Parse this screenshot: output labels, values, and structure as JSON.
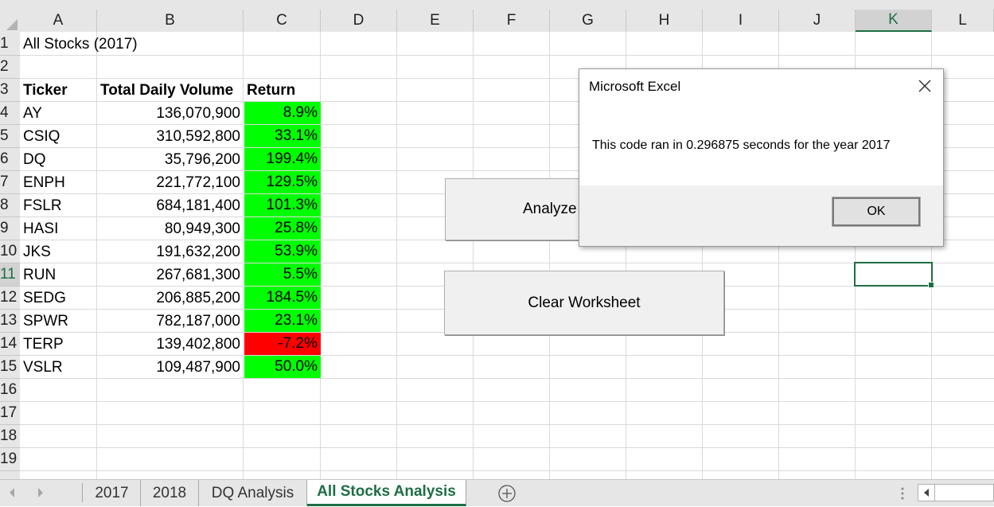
{
  "columns": [
    "A",
    "B",
    "C",
    "D",
    "E",
    "F",
    "G",
    "H",
    "I",
    "J",
    "K",
    "L"
  ],
  "rows": [
    "1",
    "2",
    "3",
    "4",
    "5",
    "6",
    "7",
    "8",
    "9",
    "10",
    "11",
    "12",
    "13",
    "14",
    "15",
    "16",
    "17",
    "18",
    "19"
  ],
  "sheet_title": "All Stocks (2017)",
  "table": {
    "headers": [
      "Ticker",
      "Total Daily Volume",
      "Return"
    ],
    "rows": [
      {
        "ticker": "AY",
        "volume": "136,070,900",
        "return": "8.9%",
        "status": "positive"
      },
      {
        "ticker": "CSIQ",
        "volume": "310,592,800",
        "return": "33.1%",
        "status": "positive"
      },
      {
        "ticker": "DQ",
        "volume": "35,796,200",
        "return": "199.4%",
        "status": "positive"
      },
      {
        "ticker": "ENPH",
        "volume": "221,772,100",
        "return": "129.5%",
        "status": "positive"
      },
      {
        "ticker": "FSLR",
        "volume": "684,181,400",
        "return": "101.3%",
        "status": "positive"
      },
      {
        "ticker": "HASI",
        "volume": "80,949,300",
        "return": "25.8%",
        "status": "positive"
      },
      {
        "ticker": "JKS",
        "volume": "191,632,200",
        "return": "53.9%",
        "status": "positive"
      },
      {
        "ticker": "RUN",
        "volume": "267,681,300",
        "return": "5.5%",
        "status": "positive"
      },
      {
        "ticker": "SEDG",
        "volume": "206,885,200",
        "return": "184.5%",
        "status": "positive"
      },
      {
        "ticker": "SPWR",
        "volume": "782,187,000",
        "return": "23.1%",
        "status": "positive"
      },
      {
        "ticker": "TERP",
        "volume": "139,402,800",
        "return": "-7.2%",
        "status": "negative"
      },
      {
        "ticker": "VSLR",
        "volume": "109,487,900",
        "return": "50.0%",
        "status": "positive"
      }
    ]
  },
  "colors": {
    "positive": "#00ff00",
    "negative": "#ff0000",
    "accent": "#1e6e43"
  },
  "buttons": {
    "analyze": "Analyze",
    "clear": "Clear Worksheet"
  },
  "dialog": {
    "title": "Microsoft Excel",
    "message": "This code ran in 0.296875 seconds for the year 2017",
    "ok": "OK",
    "close_icon": "close-icon"
  },
  "tabs": [
    {
      "label": "2017",
      "active": false
    },
    {
      "label": "2018",
      "active": false
    },
    {
      "label": "DQ Analysis",
      "active": false
    },
    {
      "label": "All Stocks Analysis",
      "active": true
    }
  ],
  "icons": {
    "prev": "prev-sheet-icon",
    "next": "next-sheet-icon",
    "add": "add-sheet-icon",
    "more": "more-options-icon"
  }
}
